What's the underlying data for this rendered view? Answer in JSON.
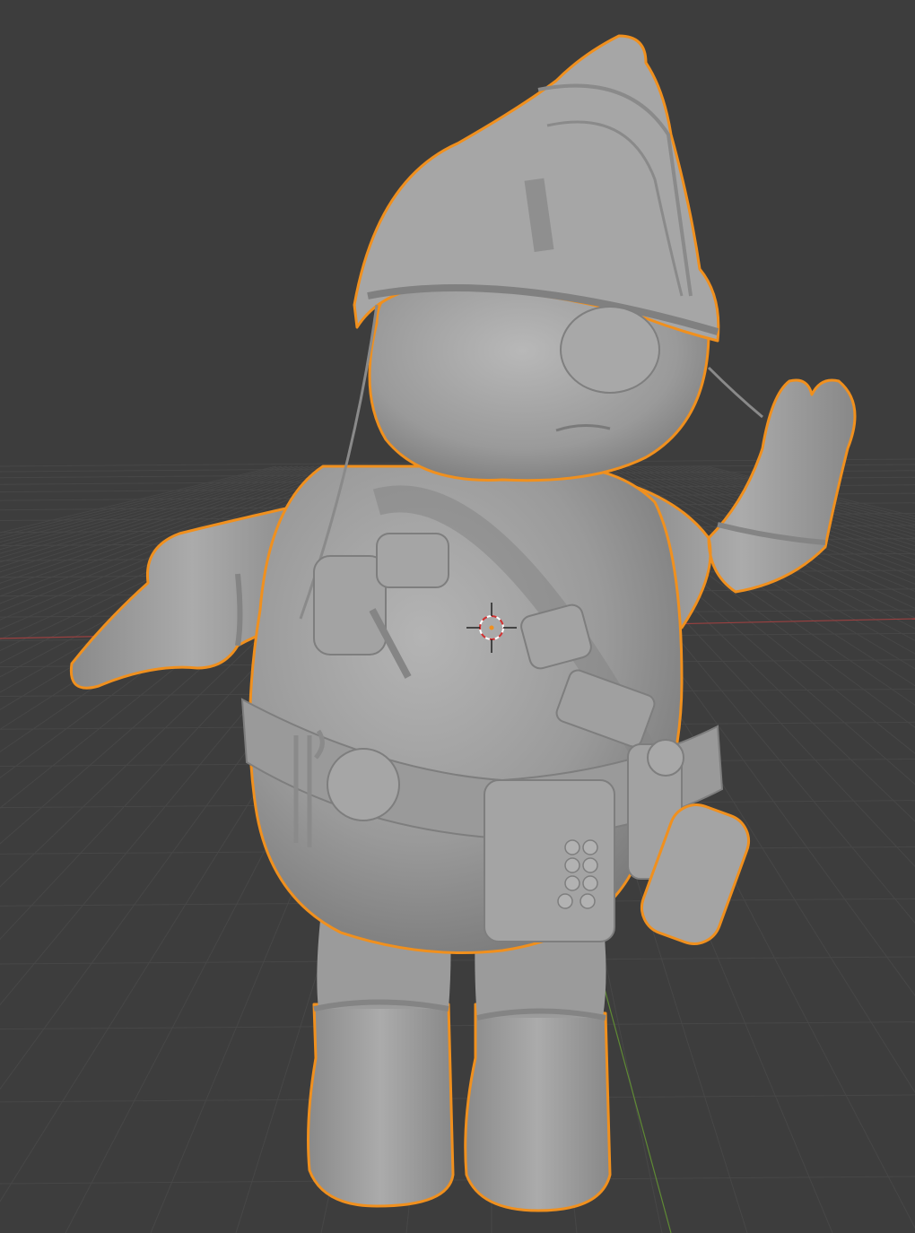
{
  "app": "3d-viewport",
  "viewport": {
    "background": "#3d3d3d",
    "grid_color": "#4a4a4a",
    "x_axis_color": "#b94a4a",
    "y_axis_color": "#6e9a3c",
    "selection_outline_color": "#f0901e",
    "model_color": "#9c9c9c",
    "object_selected": true,
    "shading": "solid"
  },
  "icons": {
    "cursor": "3d-cursor-icon"
  }
}
